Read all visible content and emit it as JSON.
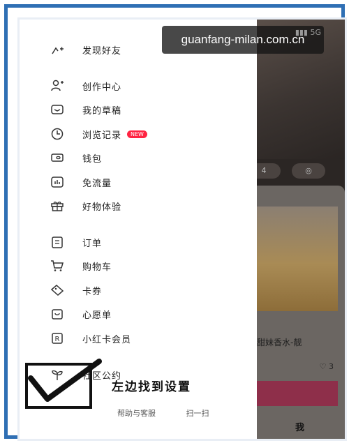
{
  "watermark": "guanfang-milan.com.cn",
  "status": {
    "network": "5G"
  },
  "drawer": {
    "top_partial": "发现好友",
    "items": [
      {
        "label": "创作中心",
        "icon": "user-plus-icon"
      },
      {
        "label": "我的草稿",
        "icon": "drafts-icon"
      },
      {
        "label": "浏览记录",
        "icon": "clock-icon",
        "badge": "NEW"
      },
      {
        "label": "钱包",
        "icon": "wallet-icon"
      },
      {
        "label": "免流量",
        "icon": "data-icon"
      },
      {
        "label": "好物体验",
        "icon": "gift-icon"
      },
      {
        "label": "订单",
        "icon": "order-icon"
      },
      {
        "label": "购物车",
        "icon": "cart-icon"
      },
      {
        "label": "卡券",
        "icon": "coupon-icon"
      },
      {
        "label": "心愿单",
        "icon": "wishlist-icon"
      },
      {
        "label": "小红卡会员",
        "icon": "member-icon"
      },
      {
        "label": "社区公约",
        "icon": "sprout-icon"
      }
    ],
    "bottom": {
      "help": "帮助与客服",
      "scan": "扫一扫"
    }
  },
  "app": {
    "pill_left": "4",
    "card_title": "甜妹香水-靓",
    "likes": "3",
    "tab_me": "我"
  },
  "annotation": {
    "note": "左边找到设置"
  },
  "colors": {
    "frame": "#2f6fb4",
    "badge": "#ff2442",
    "annotation": "#111111"
  }
}
